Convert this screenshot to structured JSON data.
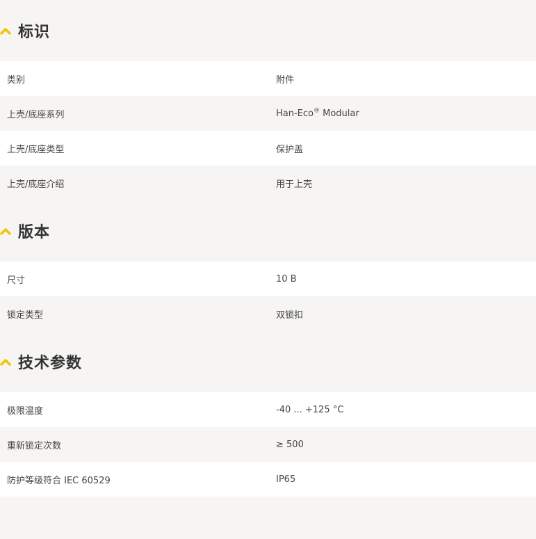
{
  "colors": {
    "accent": "#f5c400",
    "row_white": "#ffffff",
    "row_grey": "#f6f5f3"
  },
  "sections": [
    {
      "title": "标识",
      "icon": "chevron-up-icon",
      "rows": [
        {
          "label": "类别",
          "value": "附件"
        },
        {
          "label": "上壳/底座系列",
          "value": "Han-Eco",
          "value_sup": "®",
          "value_suffix": " Modular"
        },
        {
          "label": "上壳/底座类型",
          "value": "保护盖"
        },
        {
          "label": "上壳/底座介绍",
          "value": "用于上壳"
        }
      ]
    },
    {
      "title": "版本",
      "icon": "chevron-up-icon",
      "rows": [
        {
          "label": "尺寸",
          "value": "10 B"
        },
        {
          "label": "锁定类型",
          "value": "双锁扣"
        }
      ]
    },
    {
      "title": "技术参数",
      "icon": "chevron-up-icon",
      "rows": [
        {
          "label": "极限温度",
          "value": "-40 ... +125 °C"
        },
        {
          "label": "重新锁定次数",
          "value": "≥ 500"
        },
        {
          "label": "防护等级符合 IEC 60529",
          "value": "IP65"
        }
      ]
    }
  ]
}
